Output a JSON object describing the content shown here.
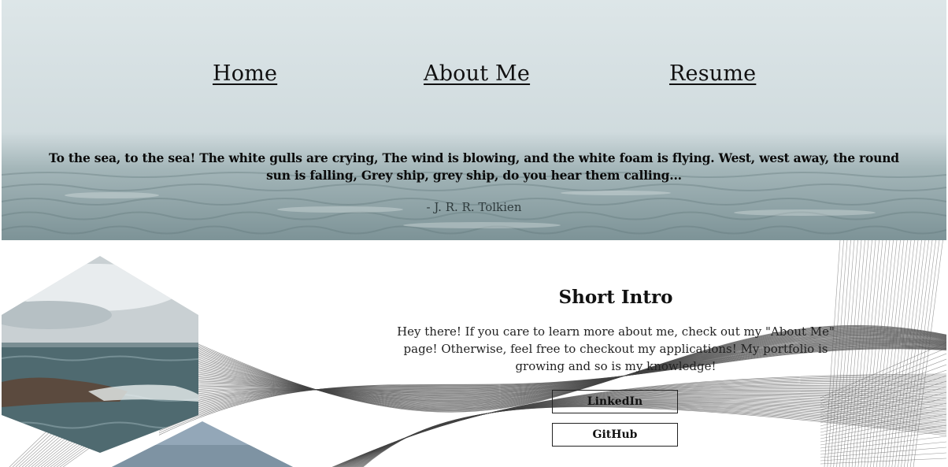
{
  "nav": {
    "home": "Home",
    "about": "About Me",
    "resume": "Resume"
  },
  "hero": {
    "quote": "To the sea, to the sea! The white gulls are crying, The wind is blowing, and the white foam is flying. West, west away, the round sun is falling, Grey ship, grey ship, do you hear them calling...",
    "author": "- J. R. R. Tolkien"
  },
  "intro": {
    "title": "Short Intro",
    "text": "Hey there! If you care to learn more about me, check out my \"About Me\" page! Otherwise, feel free to checkout my applications! My portfolio is growing and so is my knowledge!",
    "linkedin_label": "LinkedIn",
    "github_label": "GitHub"
  },
  "colors": {
    "sky": "#d6e0e3",
    "sea": "#7f9599",
    "text": "#111111"
  }
}
